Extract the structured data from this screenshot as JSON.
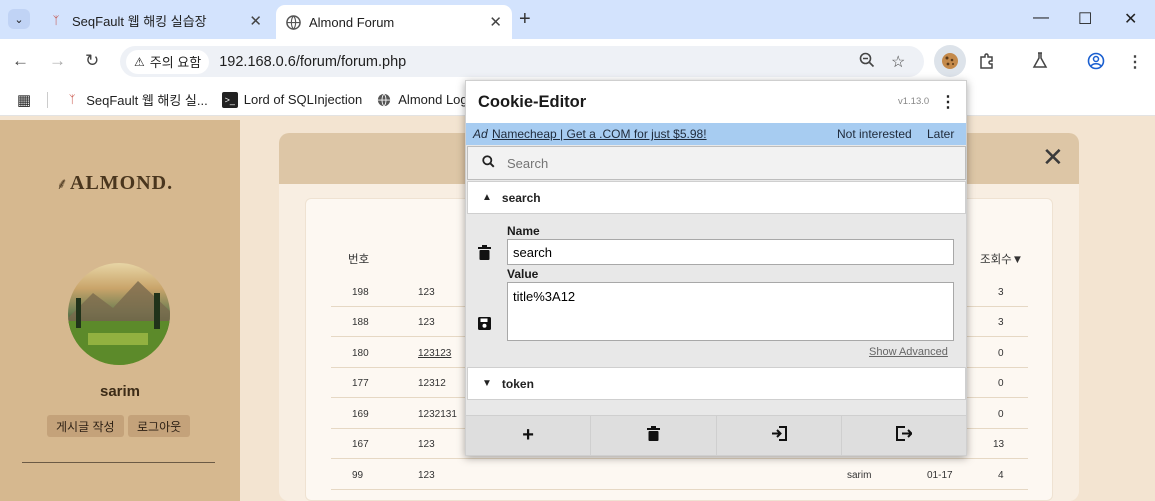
{
  "browser": {
    "tabs": [
      {
        "title": "SeqFault 웹 해킹 실습장",
        "active": false
      },
      {
        "title": "Almond Forum",
        "active": true
      }
    ],
    "new_tab_label": "+",
    "security_chip": "주의 요함",
    "url": "192.168.0.6/forum/forum.php",
    "bookmarks": [
      {
        "label": "SeqFault 웹 해킹 실...",
        "icon": "seqfault-icon"
      },
      {
        "label": "Lord of SQLInjection",
        "icon": "terminal-icon"
      },
      {
        "label": "Almond Login",
        "icon": "globe-icon"
      }
    ]
  },
  "page": {
    "logo": "ALMOND.",
    "username": "sarim",
    "buttons": [
      "게시글 작성",
      "로그아웃"
    ],
    "table": {
      "headers": {
        "num": "번호",
        "views": "조회수▼"
      },
      "rows": [
        {
          "num": "198",
          "title": "123",
          "author": "",
          "date": "",
          "views": "3"
        },
        {
          "num": "188",
          "title": "123",
          "author": "",
          "date": "",
          "views": "3"
        },
        {
          "num": "180",
          "title": "123123",
          "author": "",
          "date": "",
          "views": "0"
        },
        {
          "num": "177",
          "title": "12312",
          "author": "",
          "date": "",
          "views": "0"
        },
        {
          "num": "169",
          "title": "1232131",
          "author": "",
          "date": "",
          "views": "0"
        },
        {
          "num": "167",
          "title": "123",
          "author": "",
          "date": "",
          "views": "13"
        },
        {
          "num": "99",
          "title": "123",
          "author": "sarim",
          "date": "01-17",
          "views": "4"
        }
      ]
    }
  },
  "cookie_editor": {
    "title": "Cookie-Editor",
    "version": "v1.13.0",
    "ad": {
      "tag": "Ad",
      "link": "Namecheap | Get a .COM for just $5.98!",
      "not_interested": "Not interested",
      "later": "Later"
    },
    "search_placeholder": "Search",
    "cookies": [
      {
        "name": "search",
        "expanded": true,
        "value": "title%3A12"
      },
      {
        "name": "token",
        "expanded": false
      }
    ],
    "name_label": "Name",
    "value_label": "Value",
    "show_advanced": "Show Advanced"
  },
  "colors": {
    "tab_strip": "#d3e3fd",
    "sidebar": "#d6b88f",
    "ad_banner": "#a7ccf1"
  }
}
